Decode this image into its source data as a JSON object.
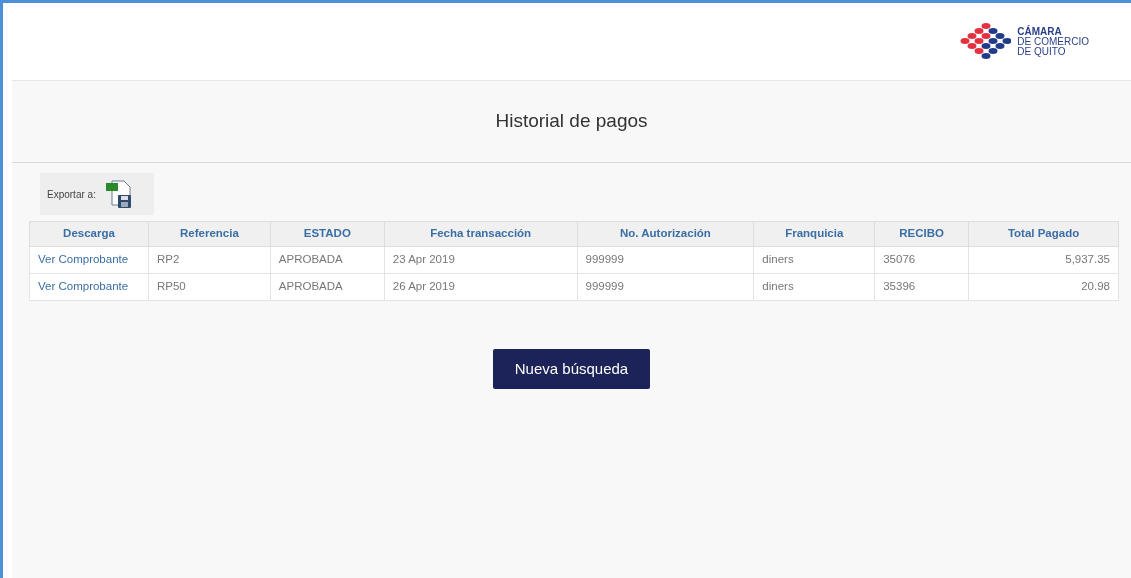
{
  "logo": {
    "lines": [
      "CÁMARA",
      "DE COMERCIO",
      "DE QUITO"
    ]
  },
  "title": "Historial de pagos",
  "export": {
    "label": "Exportar a:"
  },
  "table": {
    "columns": [
      "Descarga",
      "Referencia",
      "ESTADO",
      "Fecha transacción",
      "No. Autorización",
      "Franquicia",
      "RECIBO",
      "Total Pagado"
    ],
    "rows": [
      [
        "Ver Comprobante",
        "RP2",
        "APROBADA",
        "23 Apr 2019",
        "999999",
        "diners",
        "35076",
        "5,937.35"
      ],
      [
        "Ver Comprobante",
        "RP50",
        "APROBADA",
        "26 Apr 2019",
        "999999",
        "diners",
        "35396",
        "20.98"
      ]
    ]
  },
  "button": "Nueva búsqueda"
}
